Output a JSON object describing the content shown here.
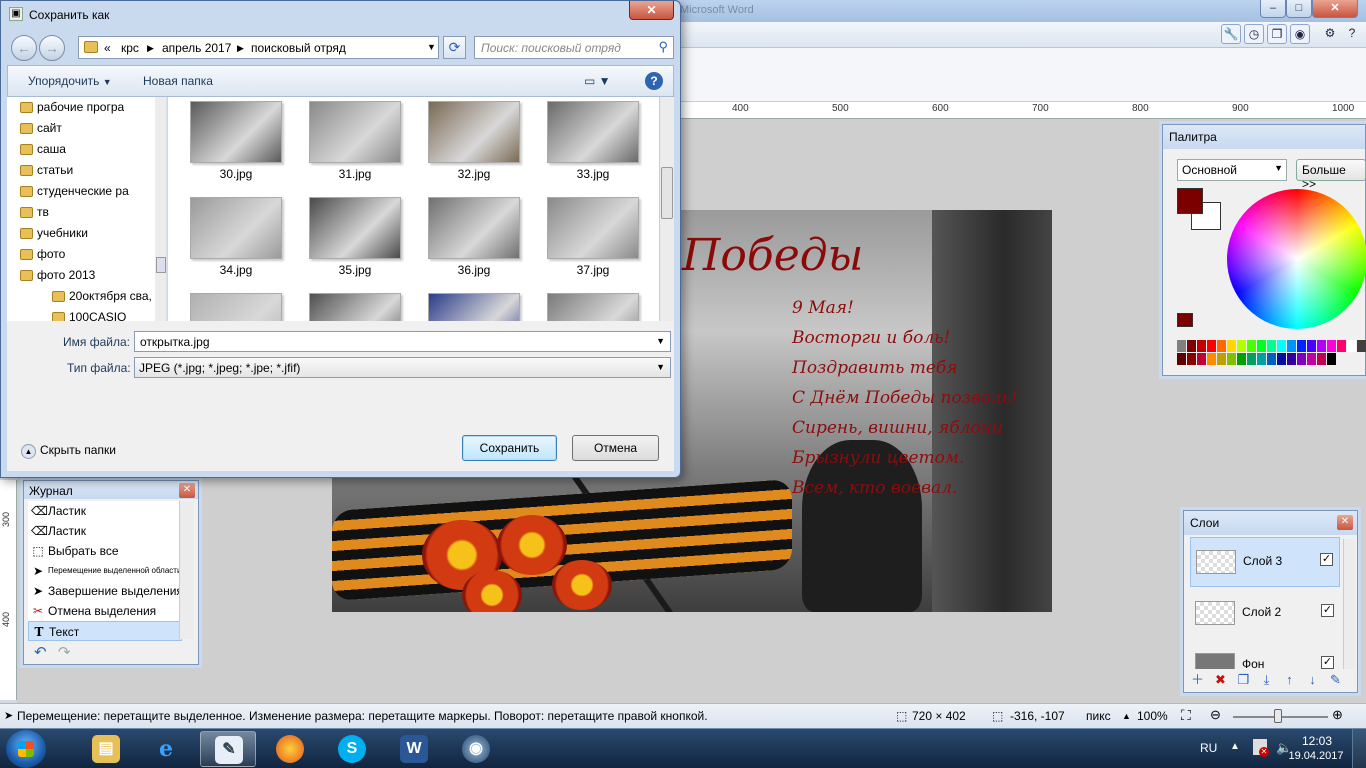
{
  "app": {
    "title_fragment": "Microsoft Word",
    "ruler_h": [
      "400",
      "500",
      "600",
      "700",
      "800",
      "900",
      "1000"
    ],
    "ruler_v": [
      "300",
      "400"
    ]
  },
  "artwork": {
    "heading": "Победы",
    "poem": [
      "9 Мая!",
      "Восторги и боль!",
      "Поздравить тебя",
      "С Днём Победы позволь!",
      "Сирень, вишни, яблони",
      "Брызнули цветом.",
      "Всем, кто воевал."
    ]
  },
  "palette": {
    "title": "Палитра",
    "mode": "Основной",
    "more": "Больше >>",
    "primary_color": "#7a0000",
    "secondary_color": "#ffffff",
    "swatches": [
      "#808080",
      "#7f0000",
      "#c00000",
      "#ff0000",
      "#ff6a00",
      "#ffd800",
      "#b6ff00",
      "#4cff00",
      "#00ff21",
      "#00ff90",
      "#00ffff",
      "#0094ff",
      "#0026ff",
      "#4800ff",
      "#b200ff",
      "#ff00dc",
      "#ff006e",
      "#ffffff",
      "#404040",
      "#5f0000",
      "#8a0000",
      "#c00030",
      "#ff8c00",
      "#c0a000",
      "#80c000",
      "#00a000",
      "#00a060",
      "#00a0a0",
      "#0060c0",
      "#0010a0",
      "#3000a0",
      "#8000c0",
      "#c000a0",
      "#c00050",
      "#000000"
    ]
  },
  "layers": {
    "title": "Слои",
    "items": [
      {
        "name": "Слой 3",
        "visible": true,
        "selected": true
      },
      {
        "name": "Слой 2",
        "visible": true,
        "selected": false
      },
      {
        "name": "Фон",
        "visible": true,
        "selected": false
      }
    ]
  },
  "history": {
    "title": "Журнал",
    "items": [
      {
        "label": "Ластик",
        "icon": "eraser-icon"
      },
      {
        "label": "Ластик",
        "icon": "eraser-icon"
      },
      {
        "label": "Выбрать все",
        "icon": "select-all-icon"
      },
      {
        "label": "Перемещение выделенной области",
        "icon": "move-selection-icon",
        "small": true
      },
      {
        "label": "Завершение выделения",
        "icon": "finish-selection-icon"
      },
      {
        "label": "Отмена выделения",
        "icon": "deselect-icon"
      },
      {
        "label": "Текст",
        "icon": "text-tool-icon",
        "selected": true
      }
    ]
  },
  "status": {
    "hint": "Перемещение: перетащите выделенное. Изменение размера: перетащите маркеры. Поворот: перетащите правой кнопкой.",
    "image_size": "720 × 402",
    "cursor": "-316, -107",
    "unit": "пикс",
    "zoom": "100%"
  },
  "dialog": {
    "title": "Сохранить как",
    "breadcrumb": [
      "«",
      "крс",
      "апрель 2017",
      "поисковый отряд"
    ],
    "search_placeholder": "Поиск: поисковый отряд",
    "organize": "Упорядочить",
    "new_folder": "Новая папка",
    "nav_items": [
      "рабочие програ",
      "сайт",
      "саша",
      "статьи",
      "студенческие ра",
      "тв",
      "учебники",
      "фото",
      "фото 2013",
      "20октября сва,",
      "100CASIO"
    ],
    "files": [
      "30.jpg",
      "31.jpg",
      "32.jpg",
      "33.jpg",
      "34.jpg",
      "35.jpg",
      "36.jpg",
      "37.jpg",
      "",
      "",
      "",
      ""
    ],
    "filename_label": "Имя файла:",
    "filename_value": "открытка.jpg",
    "filetype_label": "Тип файла:",
    "filetype_value": "JPEG (*.jpg; *.jpeg; *.jpe; *.jfif)",
    "hide_folders": "Скрыть папки",
    "save": "Сохранить",
    "cancel": "Отмена"
  },
  "taskbar": {
    "lang": "RU",
    "time": "12:03",
    "date": "19.04.2017"
  }
}
